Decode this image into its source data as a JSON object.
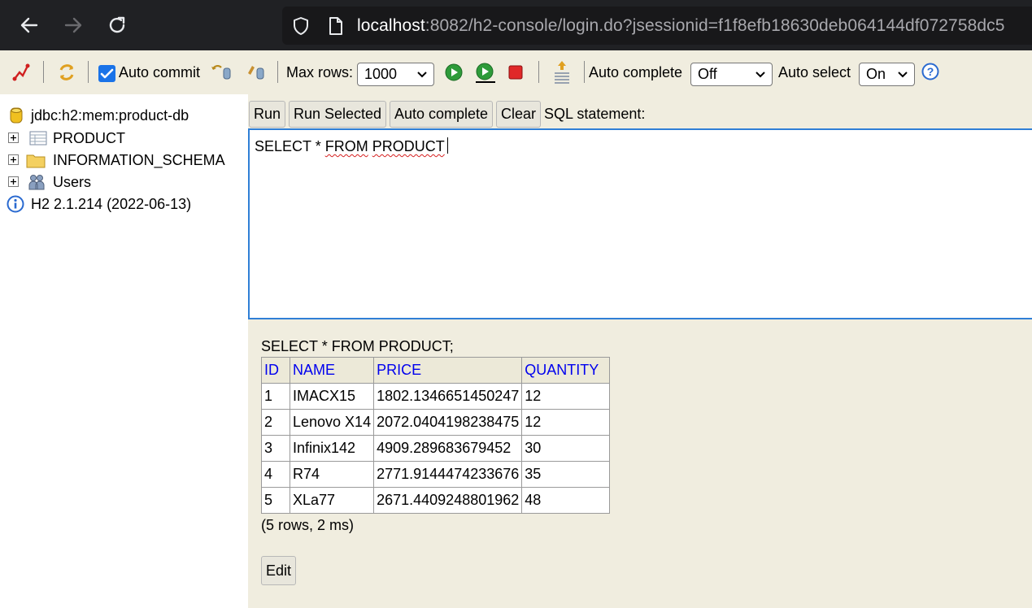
{
  "browser": {
    "url_host": "localhost",
    "url_rest": ":8082/h2-console/login.do?jsessionid=f1f8efb18630deb064144df072758dc5"
  },
  "toolbar": {
    "auto_commit_label": "Auto commit",
    "auto_commit_checked": true,
    "max_rows_label": "Max rows:",
    "max_rows_value": "1000",
    "auto_complete_label": "Auto complete",
    "auto_complete_value": "Off",
    "auto_select_label": "Auto select",
    "auto_select_value": "On"
  },
  "tree": {
    "connection": "jdbc:h2:mem:product-db",
    "items": [
      {
        "label": "PRODUCT",
        "icon": "table-icon"
      },
      {
        "label": "INFORMATION_SCHEMA",
        "icon": "folder-icon"
      },
      {
        "label": "Users",
        "icon": "users-icon"
      }
    ],
    "version": "H2 2.1.214 (2022-06-13)"
  },
  "editor": {
    "buttons": [
      "Run",
      "Run Selected",
      "Auto complete",
      "Clear"
    ],
    "sql_label": "SQL statement:",
    "text_plain": "SELECT * ",
    "text_word1": "FROM",
    "text_word2": "PRODUCT"
  },
  "result": {
    "query": "SELECT * FROM PRODUCT;",
    "columns": [
      "ID",
      "NAME",
      "PRICE",
      "QUANTITY"
    ],
    "rows": [
      [
        "1",
        "IMACX15",
        "1802.1346651450247",
        "12"
      ],
      [
        "2",
        "Lenovo X14",
        "2072.0404198238475",
        "12"
      ],
      [
        "3",
        "Infinix142",
        "4909.289683679452",
        "30"
      ],
      [
        "4",
        "R74",
        "2771.9144474233676",
        "35"
      ],
      [
        "5",
        "XLa77",
        "2671.4409248801962",
        "48"
      ]
    ],
    "rows_info": "(5 rows, 2 ms)",
    "edit_label": "Edit"
  },
  "colors": {
    "panel_bg": "#f0eddf",
    "header_link": "#0000ee",
    "editor_border": "#2f7fd6"
  }
}
